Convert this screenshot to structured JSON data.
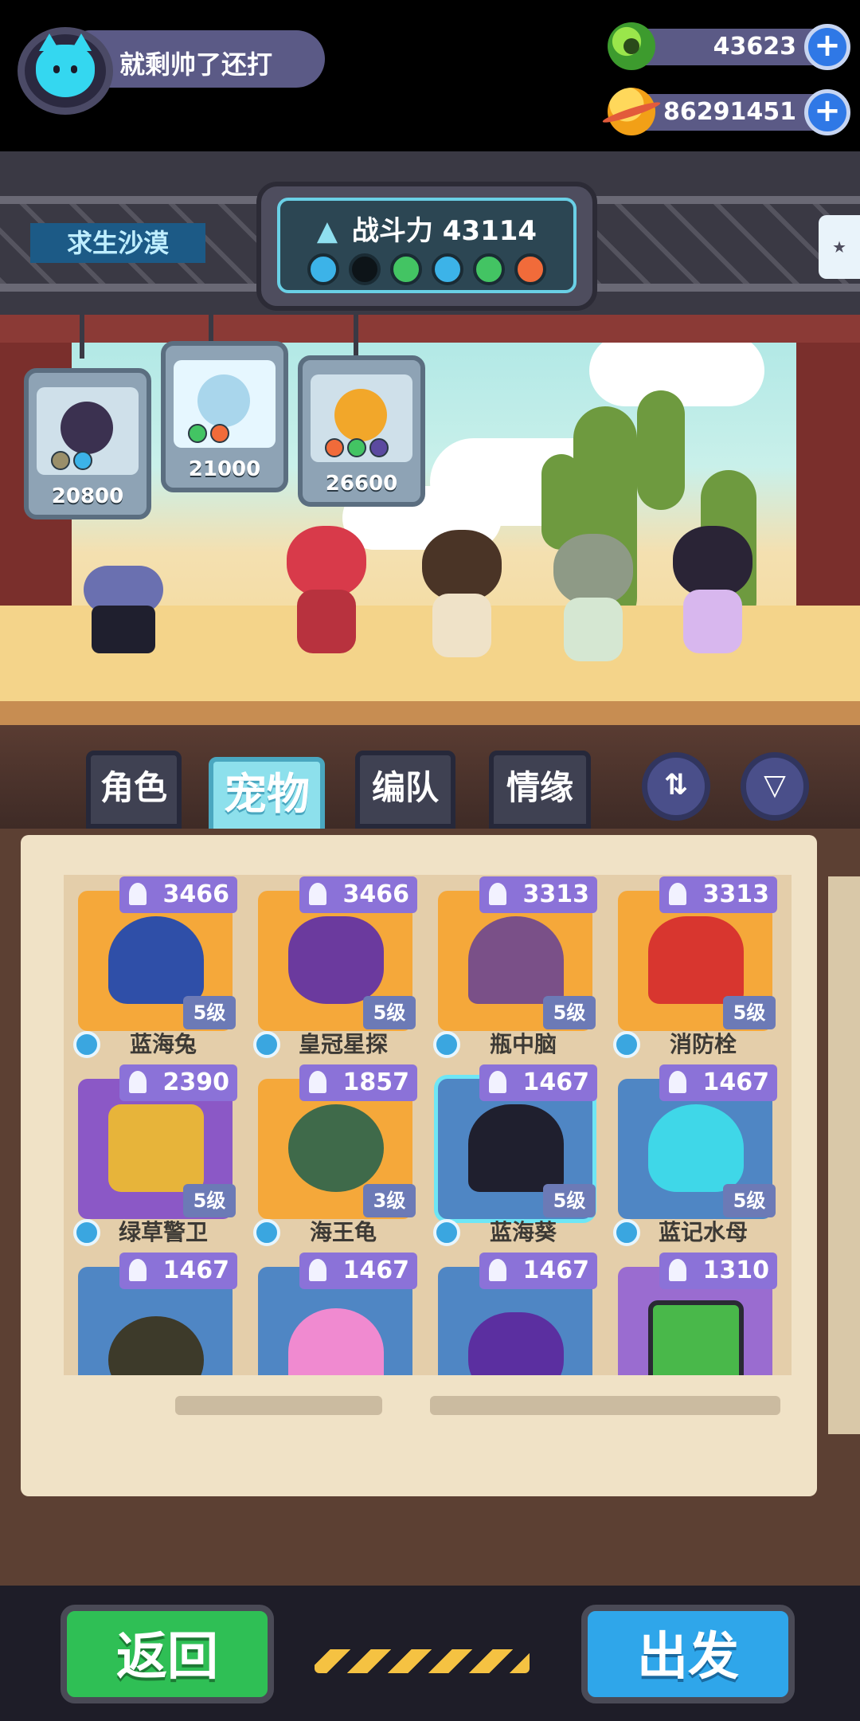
{
  "player": {
    "name": "就剩帅了还打"
  },
  "currency": {
    "gems": "43623",
    "coins": "86291451",
    "add_label": "+"
  },
  "scene": {
    "map_name": "求生沙漠",
    "power_label": "战斗力",
    "power_value": "43114",
    "share_icon": "share-icon",
    "team_slots": [
      "water",
      "empty",
      "grass",
      "water",
      "grass",
      "fire"
    ]
  },
  "team_pets": [
    {
      "power": "20800"
    },
    {
      "power": "21000"
    },
    {
      "power": "26600"
    }
  ],
  "tabs": [
    {
      "label": "角色"
    },
    {
      "label": "宠物"
    },
    {
      "label": "编队"
    },
    {
      "label": "情缘"
    }
  ],
  "toolbar": {
    "sort_icon": "sort-icon",
    "filter_icon": "filter-icon"
  },
  "pets": [
    {
      "power": "3466",
      "level": "5级",
      "name": "蓝海兔",
      "bg": "orange",
      "color": "#2f4fa8"
    },
    {
      "power": "3466",
      "level": "5级",
      "name": "皇冠星探",
      "bg": "orange",
      "color": "#6b3a9e"
    },
    {
      "power": "3313",
      "level": "5级",
      "name": "瓶中脑",
      "bg": "orange",
      "color": "#7a5088"
    },
    {
      "power": "3313",
      "level": "5级",
      "name": "消防栓",
      "bg": "orange",
      "color": "#d8362f"
    },
    {
      "power": "2390",
      "level": "5级",
      "name": "绿草警卫",
      "bg": "purple",
      "color": "#e7b43a"
    },
    {
      "power": "1857",
      "level": "3级",
      "name": "海王龟",
      "bg": "orange",
      "color": "#3f6a4a"
    },
    {
      "power": "1467",
      "level": "5级",
      "name": "蓝海葵",
      "bg": "blue",
      "color": "#1f1f2e"
    },
    {
      "power": "1467",
      "level": "5级",
      "name": "蓝记水母",
      "bg": "blue",
      "color": "#3fd7e8"
    },
    {
      "power": "1467",
      "level": "",
      "name": "",
      "bg": "blue",
      "color": "#3d3a2a"
    },
    {
      "power": "1467",
      "level": "",
      "name": "",
      "bg": "blue",
      "color": "#f08ad0"
    },
    {
      "power": "1467",
      "level": "",
      "name": "",
      "bg": "blue",
      "color": "#5b2fa0"
    },
    {
      "power": "1310",
      "level": "",
      "name": "",
      "bg": "violet",
      "color": "#49b84a"
    }
  ],
  "buttons": {
    "back": "返回",
    "go": "出发"
  },
  "colors": {
    "accent_blue": "#2fa6ea",
    "accent_green": "#2fbf55",
    "power_badge": "#8b72d8"
  }
}
